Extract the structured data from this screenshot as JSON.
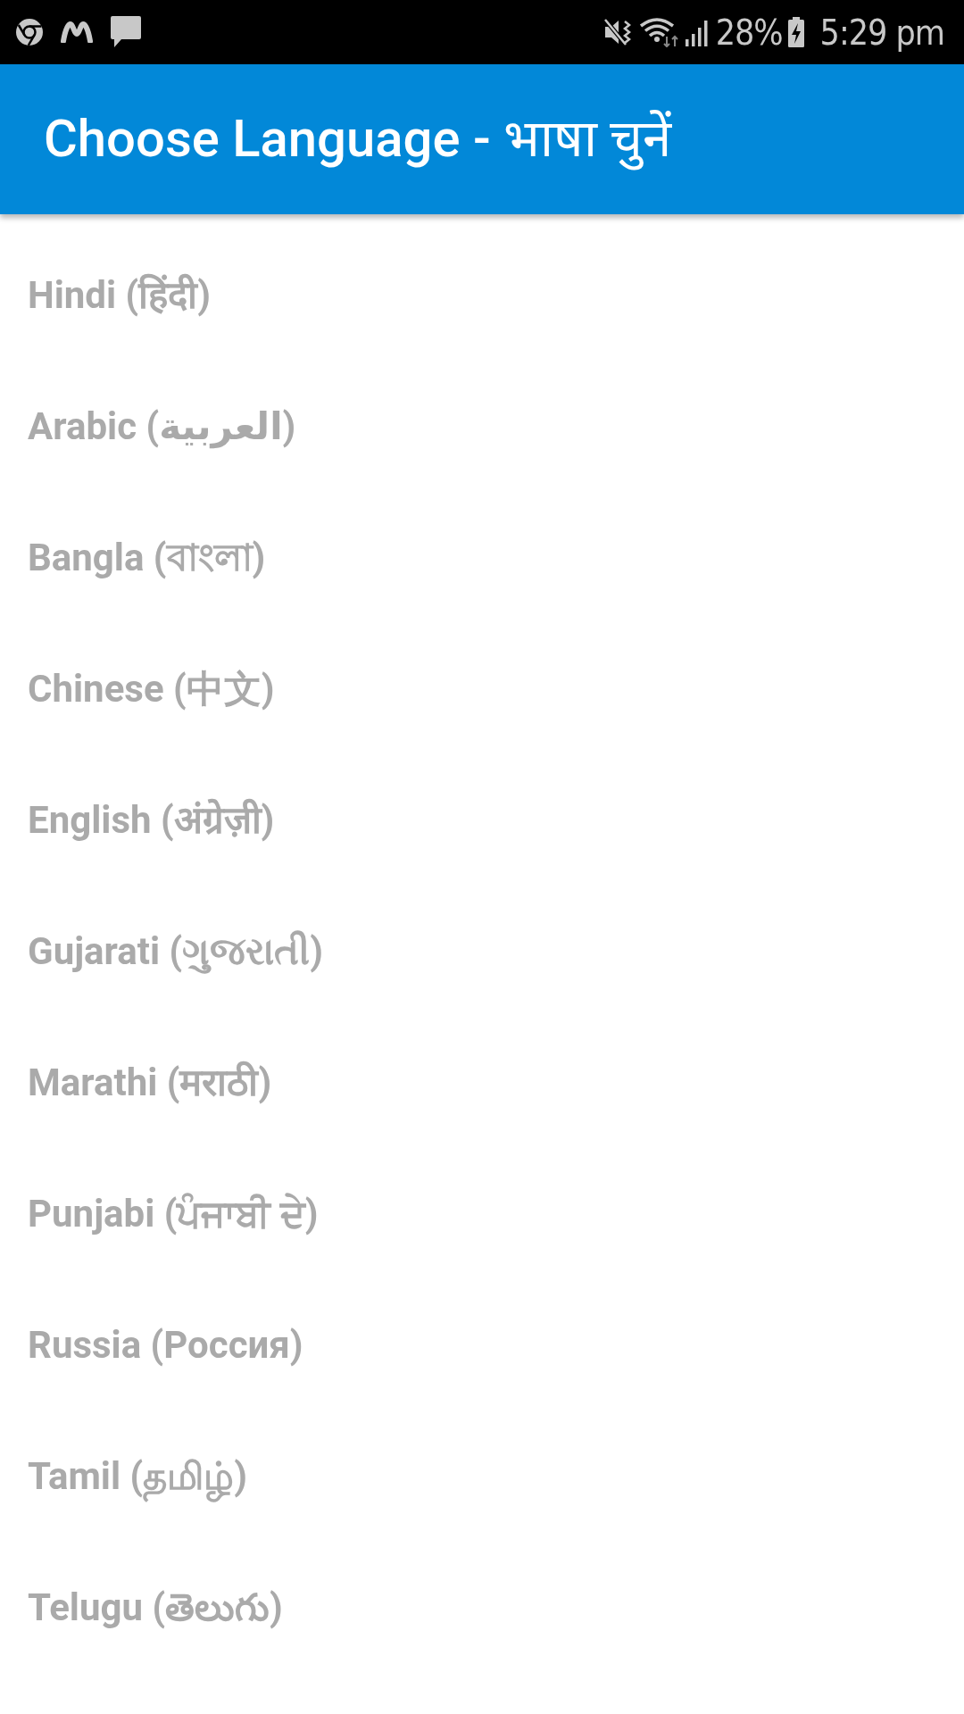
{
  "status_bar": {
    "battery_text": "28%",
    "time": "5:29 pm"
  },
  "app_bar": {
    "title": "Choose Language - भाषा चुनें"
  },
  "languages": [
    {
      "label": "Hindi (हिंदी)"
    },
    {
      "label": "Arabic (العربية)"
    },
    {
      "label": "Bangla (বাংলা)"
    },
    {
      "label": "Chinese (中文)"
    },
    {
      "label": "English (अंग्रेज़ी)"
    },
    {
      "label": "Gujarati (ગુજરાતી)"
    },
    {
      "label": "Marathi (मराठी)"
    },
    {
      "label": "Punjabi (ਪੰਜਾਬੀ ਦੇ)"
    },
    {
      "label": "Russia (Россия)"
    },
    {
      "label": "Tamil (தமிழ்)"
    },
    {
      "label": "Telugu (తెలుగు)"
    }
  ]
}
